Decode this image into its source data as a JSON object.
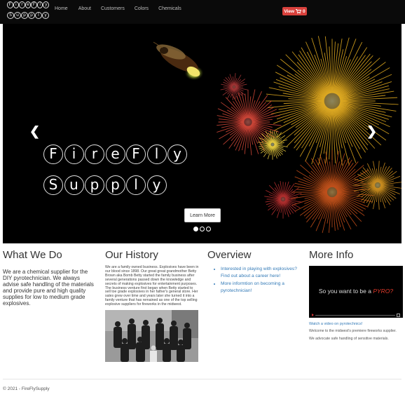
{
  "navbar": {
    "logo_line1": [
      "F",
      "i",
      "r",
      "e",
      "F",
      "l",
      "y"
    ],
    "logo_line2": [
      "S",
      "u",
      "p",
      "p",
      "l",
      "y"
    ],
    "links": [
      "Home",
      "About",
      "Customers",
      "Colors",
      "Chemicals"
    ],
    "cart_label": "View",
    "cart_count": "0",
    "cart_icon": "shopping-cart-icon"
  },
  "hero": {
    "title_line1": [
      "F",
      "i",
      "r",
      "e",
      "F",
      "l",
      "y"
    ],
    "title_line2": [
      "S",
      "u",
      "p",
      "p",
      "l",
      "y"
    ],
    "button_label": "Learn More",
    "slides_total": 3,
    "active_slide": 1,
    "prev_icon": "chevron-left-icon",
    "next_icon": "chevron-right-icon"
  },
  "what_we_do": {
    "heading": "What We Do",
    "body": "We are a chemical supplier for the DIY pyrotechnician. We always advise safe handling of the materials and provide pure and high quality supplies for low to medium grade explosives."
  },
  "history": {
    "heading": "Our History",
    "body": "We are a family owned business. Explosives have been in our blood since 1898. Our great great grandmother Betty Brown aka Bomb Betty started the family business after several generations passed down the knowledge and secrets of making explosives for entertainment purposes. The business venture first began when Betty started to sell toe grade explosives in her father's general store. Her sales grew over time and years later she turned it into a family venture that has remained as one of the top selling explosive suppliers for fireworks in the midwest."
  },
  "overview": {
    "heading": "Overview",
    "items": [
      "Interested in playing with explosives? Find out about a career here!",
      "More informtion on becoming a pyrotechnician!"
    ]
  },
  "more_info": {
    "heading": "More Info",
    "video_text_before": "So you want to be a ",
    "video_text_accent": "PYRO?",
    "link": "Watch a video on pyrotechnics!",
    "para1": "Welcome to the midwest's premiere fireworks supplier.",
    "para2": "We advocate safe handling of sensitive materials."
  },
  "footer": {
    "text": "© 2021 - FireFlySupply"
  },
  "colors": {
    "navbar_bg": "#0a0a0a",
    "cart_button": "#d9413c",
    "link": "#337ab7",
    "accent_pyro": "#e23a2a"
  }
}
